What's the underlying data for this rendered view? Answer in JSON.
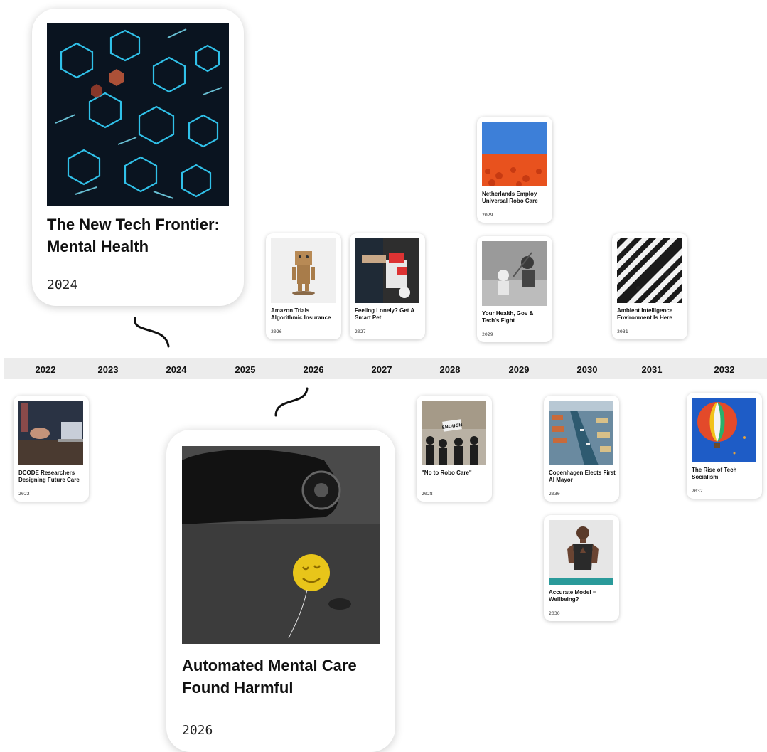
{
  "timeline": {
    "years": [
      "2022",
      "2023",
      "2024",
      "2025",
      "2026",
      "2027",
      "2028",
      "2029",
      "2030",
      "2031",
      "2032"
    ]
  },
  "featured": [
    {
      "title": "The New Tech Frontier: Mental Health",
      "year": "2024",
      "image": "blue-neon-hexagons"
    },
    {
      "title": "Automated Mental Care Found Harmful",
      "year": "2026",
      "image": "deflated-smiley-balloon-street"
    }
  ],
  "cards": {
    "amazon": {
      "title": "Amazon Trials Algorithmic Insurance",
      "year": "2026",
      "image": "cardboard-robot-toy"
    },
    "lonely": {
      "title": "Feeling Lonely? Get A Smart Pet",
      "year": "2027",
      "image": "robot-pet"
    },
    "netherlands": {
      "title": "Netherlands Employ Universal Robo Care",
      "year": "2029",
      "image": "tulip-field"
    },
    "health": {
      "title": "Your Health, Gov & Tech's Fight",
      "year": "2029",
      "image": "lego-figures-fight"
    },
    "ambient": {
      "title": "Ambient Intelligence Environment Is Here",
      "year": "2031",
      "image": "crosswalk-aerial"
    },
    "dcode": {
      "title": "DCODE Researchers Designing Future Care",
      "year": "2022",
      "image": "meeting-laptop"
    },
    "norobo": {
      "title": "\"No to Robo Care\"",
      "year": "2028",
      "image": "protest-crowd",
      "sign": "ENOUGH"
    },
    "copenhagen": {
      "title": "Copenhagen Elects First AI Mayor",
      "year": "2030",
      "image": "copenhagen-canal"
    },
    "accurate": {
      "title": "Accurate Model = Wellbeing?",
      "year": "2030",
      "image": "woman-meditating"
    },
    "balloon": {
      "title": "The Rise of Tech Socialism",
      "year": "2032",
      "image": "hot-air-balloon"
    }
  }
}
